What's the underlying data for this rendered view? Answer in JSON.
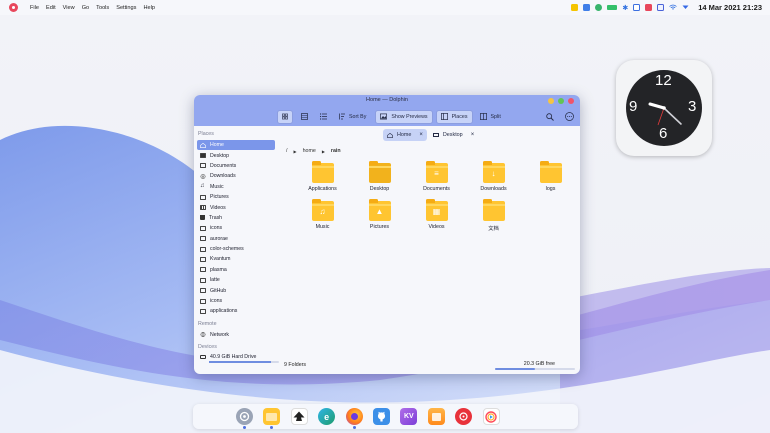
{
  "topbar": {
    "menu": [
      "File",
      "Edit",
      "View",
      "Go",
      "Tools",
      "Settings",
      "Help"
    ],
    "clock": "14 Mar 2021 21:23",
    "tray_icons": [
      "note-icon",
      "folder-icon",
      "cloud-icon",
      "battery-icon",
      "bluetooth-icon",
      "clipboard-icon",
      "mail-icon",
      "notes-icon",
      "wifi-icon",
      "chevron-down-icon"
    ]
  },
  "clock_widget": {
    "numerals": [
      "12",
      "3",
      "6",
      "9"
    ]
  },
  "window": {
    "title": "Home — Dolphin",
    "toolbar": {
      "sort_by": "Sort By",
      "show_previews": "Show Previews",
      "places": "Places",
      "split": "Split"
    },
    "sidebar": {
      "places_header": "Places",
      "places": [
        "Home",
        "Desktop",
        "Documents",
        "Downloads",
        "Music",
        "Pictures",
        "Videos",
        "Trash",
        "icons",
        "aurorae",
        "color-schemes",
        "Kvantum",
        "plasma",
        "latte",
        "GitHub",
        "icons",
        "applications"
      ],
      "remote_header": "Remote",
      "remote": [
        "Network"
      ],
      "devices_header": "Devices",
      "devices": [
        "40.9 GiB Hard Drive"
      ],
      "drive_usage": 0.88
    },
    "tabs": [
      "Home",
      "Desktop"
    ],
    "breadcrumb": [
      "/",
      "home",
      "rain"
    ],
    "files": [
      {
        "name": "Applications",
        "glyph": ""
      },
      {
        "name": "Desktop",
        "glyph": ""
      },
      {
        "name": "Documents",
        "glyph": "≡"
      },
      {
        "name": "Downloads",
        "glyph": "↓"
      },
      {
        "name": "logs",
        "glyph": ""
      },
      {
        "name": "Music",
        "glyph": "♫"
      },
      {
        "name": "Pictures",
        "glyph": "▲"
      },
      {
        "name": "Videos",
        "glyph": "▦"
      },
      {
        "name": "文档",
        "glyph": ""
      }
    ],
    "status": {
      "folders": "9 Folders",
      "free": "20.3 GiB free",
      "used_fraction": 0.5
    }
  },
  "dock": {
    "apps": [
      {
        "name": "settings",
        "bg": "#9aa4b6",
        "label": "",
        "running": true
      },
      {
        "name": "files",
        "bg": "#ffc531",
        "label": "",
        "running": true
      },
      {
        "name": "inkscape",
        "bg": "#ffffff",
        "label": "",
        "running": false
      },
      {
        "name": "edge",
        "bg": "#1e9c6c",
        "label": "",
        "running": false
      },
      {
        "name": "firefox",
        "bg": "#ff7b1c",
        "label": "",
        "running": true
      },
      {
        "name": "github",
        "bg": "#3c8fe8",
        "label": "",
        "running": false
      },
      {
        "name": "kvantum",
        "bg": "#9b5de5",
        "label": "KV",
        "running": false
      },
      {
        "name": "store",
        "bg": "#ff9a2e",
        "label": "",
        "running": false
      },
      {
        "name": "music",
        "bg": "#e8323b",
        "label": "",
        "running": false
      },
      {
        "name": "player",
        "bg": "#ffffff",
        "label": "",
        "running": false
      }
    ]
  },
  "colors": {
    "accent": "#7b96ea",
    "titlebar": "#93a7ef",
    "folder": "#ffc531",
    "close": "#f1546a",
    "minimize": "#f5c543",
    "maximize": "#62c554"
  }
}
